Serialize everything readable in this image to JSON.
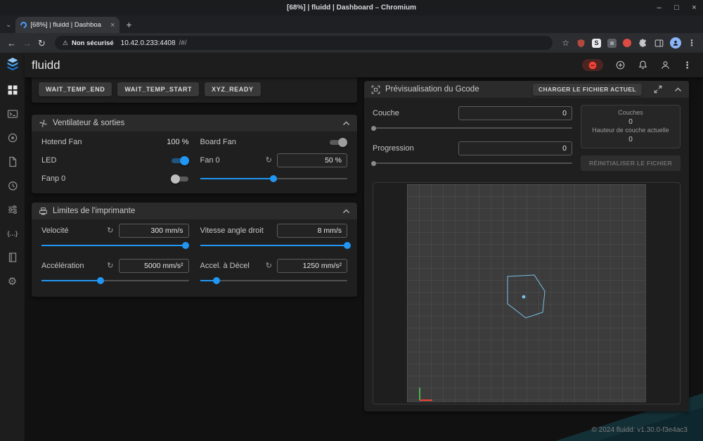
{
  "window": {
    "title": "[68%] | fluidd | Dashboard – Chromium"
  },
  "browser": {
    "tab_title": "[68%] | fluidd | Dashboa",
    "security_label": "Non sécurisé",
    "url_host": "10.42.0.233:4408",
    "url_path": "/#/"
  },
  "icons": {
    "tab_search": "⌄",
    "new_tab": "+",
    "tab_close": "×",
    "minimize": "–",
    "maximize": "□",
    "close": "×",
    "back": "←",
    "forward": "→",
    "reload": "↻",
    "warning": "⚠",
    "star": "☆",
    "ext_s": "S",
    "kebab": "⋮",
    "reset": "↻",
    "macros_brace": "{…}",
    "gear": "⚙"
  },
  "appbar": {
    "title": "fluidd"
  },
  "macros": {
    "buttons": [
      "WAIT_TEMP_END",
      "WAIT_TEMP_START",
      "XYZ_READY"
    ]
  },
  "fans_card": {
    "title": "Ventilateur & sorties",
    "hotend_label": "Hotend Fan",
    "hotend_value": "100 %",
    "board_label": "Board Fan",
    "board_fan_on": true,
    "led_label": "LED",
    "led_on": true,
    "fan0_label": "Fan 0",
    "fan0_value": "50 %",
    "fan0_slider": 50,
    "fanp0_label": "Fanp 0",
    "fanp0_on": false
  },
  "limits_card": {
    "title": "Limites de l'imprimante",
    "velocity_label": "Velocité",
    "velocity_value": "300 mm/s",
    "velocity_slider": 98,
    "scv_label": "Vitesse angle droit",
    "scv_value": "8 mm/s",
    "scv_slider": 100,
    "accel_label": "Accélération",
    "accel_value": "5000 mm/s²",
    "accel_slider": 40,
    "accel_to_decel_label": "Accel. à Décel",
    "accel_to_decel_value": "1250 mm/s²",
    "accel_to_decel_slider": 11
  },
  "gcode_card": {
    "title": "Prévisualisation du Gcode",
    "load_button": "CHARGER LE FICHIER ACTUEL",
    "layer_label": "Couche",
    "layer_value": "0",
    "layer_slider": 0,
    "progress_label": "Progression",
    "progress_value": "0",
    "progress_slider": 0,
    "layers_label": "Couches",
    "layers_value": "0",
    "layer_height_label": "Hauteur de couche actuelle",
    "layer_height_value": "0",
    "reset_button": "RÉINITIALISER LE FICHIER"
  },
  "footer": "© 2024 fluidd: v1.30.0-f3e4ac3"
}
